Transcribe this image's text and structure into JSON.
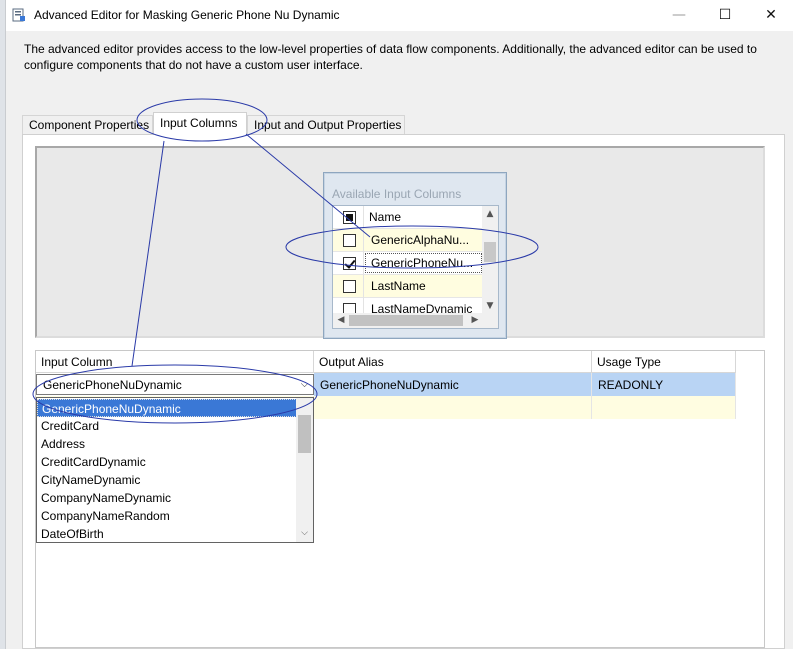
{
  "window": {
    "title": "Advanced Editor for Masking Generic Phone Nu Dynamic",
    "minimize_glyph": "—",
    "maximize_glyph": "☐",
    "close_glyph": "✕"
  },
  "description": "The advanced editor provides access to the low-level properties of data flow components. Additionally, the advanced editor can be used to configure components that do not have a custom user interface.",
  "tabs": [
    {
      "label": "Component Properties",
      "active": false
    },
    {
      "label": "Input Columns",
      "active": true
    },
    {
      "label": "Input and Output Properties",
      "active": false
    }
  ],
  "available_columns": {
    "title": "Available Input Columns",
    "header": "Name",
    "rows": [
      {
        "name": "GenericAlphaNu...",
        "checked": false
      },
      {
        "name": "GenericPhoneNu...",
        "checked": true
      },
      {
        "name": "LastName",
        "checked": false
      },
      {
        "name": "LastNameDynamic",
        "checked": false
      }
    ]
  },
  "grid": {
    "headers": [
      "Input Column",
      "Output Alias",
      "Usage Type"
    ],
    "rows": [
      {
        "input_column": "GenericPhoneNuDynamic",
        "output_alias": "GenericPhoneNuDynamic",
        "usage_type": "READONLY"
      }
    ]
  },
  "dropdown": {
    "selected": "GenericPhoneNuDynamic",
    "options": [
      "GenericPhoneNuDynamic",
      "CreditCard",
      "Address",
      "CreditCardDynamic",
      "CityNameDynamic",
      "CompanyNameDynamic",
      "CompanyNameRandom",
      "DateOfBirth"
    ]
  },
  "colors": {
    "annotation": "#2a3aa8",
    "selection": "#3a78d6",
    "row_highlight": "#b9d4f4",
    "new_row": "#fffde1"
  }
}
